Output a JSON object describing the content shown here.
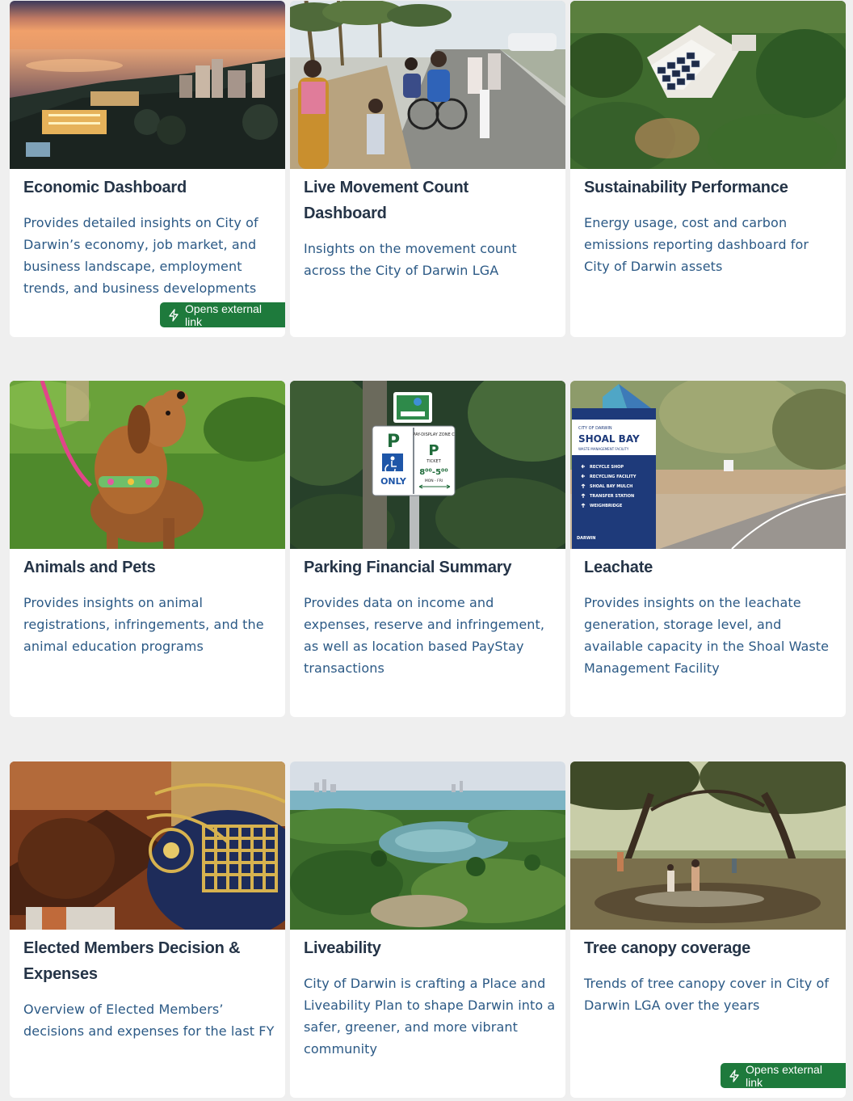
{
  "cards": [
    {
      "title": "Economic Dashboard",
      "description": "Provides detailed insights on City of Darwin’s economy, job market, and business landscape, employment trends, and business developments",
      "badge": "Opens external link",
      "image_icon": "sunset-city-aerial-image"
    },
    {
      "title": "Live Movement Count Dashboard",
      "description": "Insights on the movement count across the City of Darwin LGA",
      "image_icon": "cyclists-pedestrians-path-image"
    },
    {
      "title": "Sustainability Performance",
      "description": "Energy usage, cost and carbon emissions reporting dashboard for City of Darwin assets",
      "image_icon": "solar-roof-aerial-image"
    },
    {
      "title": "Animals and Pets",
      "description": "Provides insights on animal registrations, infringements, and the animal education programs",
      "image_icon": "dachshund-dog-image"
    },
    {
      "title": "Parking Financial Summary",
      "description": "Provides data on income and expenses, reserve and infringement, as well as location based PayStay transactions",
      "image_icon": "parking-sign-image",
      "sign_text": {
        "p_left": "P",
        "p_right": "P",
        "only": "ONLY",
        "zone": "PAY-DISPLAY ZONE C",
        "ticket": "TICKET",
        "hours": "8⁰⁰-5⁰⁰",
        "days": "MON - FRI"
      }
    },
    {
      "title": "Leachate",
      "description": "Provides insights on the leachate generation, storage level, and available capacity in the Shoal Waste Management Facility",
      "image_icon": "shoal-bay-sign-image",
      "sign_text": {
        "top": "CITY OF DARWIN",
        "name": "SHOAL BAY",
        "sub": "WASTE MANAGEMENT FACILITY",
        "items": [
          "RECYCLE SHOP",
          "RECYCLING FACILITY",
          "SHOAL BAY MULCH",
          "TRANSFER STATION",
          "WEIGHBRIDGE"
        ],
        "footer": "DARWIN"
      }
    },
    {
      "title": "Elected Members Decision & Expenses",
      "description": "Overview of Elected Members’ decisions and expenses for the last FY",
      "image_icon": "gavel-mace-image"
    },
    {
      "title": "Liveability",
      "description": "City of Darwin is crafting a Place and Liveability Plan to shape Darwin into a safer, greener, and more vibrant community",
      "image_icon": "darwin-parkland-aerial-image"
    },
    {
      "title": "Tree canopy coverage",
      "description": "Trends of tree canopy cover in City of Darwin LGA over the years",
      "badge": "Opens external link",
      "image_icon": "tree-canopy-park-image"
    }
  ],
  "colors": {
    "title": "#253447",
    "description": "#2b5985",
    "badge": "#1e7a3c",
    "page_bg": "#efefef"
  }
}
